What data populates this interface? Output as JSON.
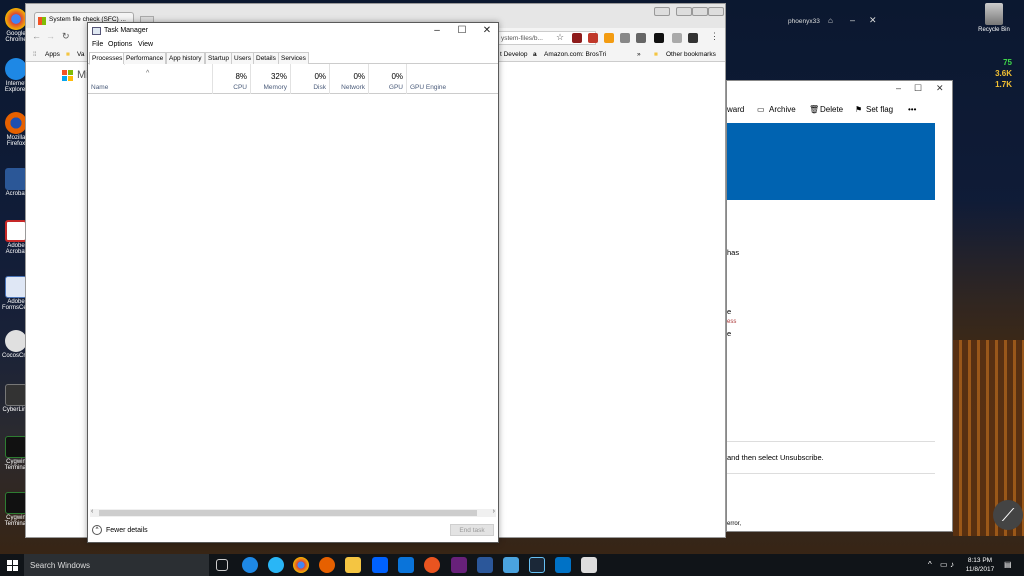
{
  "desktop": {
    "icons": [
      {
        "label": "Google Chrome",
        "color": "#dd4b39"
      },
      {
        "label": "Internet Explorer",
        "color": "#1e88e5"
      },
      {
        "label": "Mozilla Firefox",
        "color": "#e66000"
      },
      {
        "label": "Acrobat",
        "color": "#2b5797"
      },
      {
        "label": "Adobe Acrobat",
        "color": "#c62828"
      },
      {
        "label": "Adobe FormsCentral",
        "color": "#4a74b8"
      },
      {
        "label": "CocosCreator",
        "color": "#e0e0e0"
      },
      {
        "label": "CyberLink",
        "color": "#333333"
      },
      {
        "label": "Cygwin Terminal",
        "color": "#2e7d32"
      },
      {
        "label": "Cygwin Terminal",
        "color": "#2e7d32"
      }
    ],
    "recycle_bin": "Recycle Bin",
    "hw_monitor": {
      "line1": "75",
      "line2": "3.6K",
      "line3": "1.7K"
    }
  },
  "chrome": {
    "tab_title": "System file check (SFC) ...",
    "address": "ystem-files/b...",
    "bookmarks_apps": "Apps",
    "bookmarks": [
      "Va",
      "t Develop",
      "Amazon.com: BrosTri",
      "Other bookmarks"
    ],
    "ms_text": "Mi"
  },
  "mail": {
    "toolbar": {
      "forward": "ward",
      "archive": "Archive",
      "delete": "Delete",
      "set_flag": "Set flag",
      "more": "•••"
    },
    "user": "phoenyx33",
    "snippets": [
      "has",
      "e",
      "ess",
      "e"
    ],
    "unsubscribe": "and then select Unsubscribe.",
    "footer": "error,"
  },
  "taskmanager": {
    "title": "Task Manager",
    "menu": [
      "File",
      "Options",
      "View"
    ],
    "tabs": [
      "Processes",
      "Performance",
      "App history",
      "Startup",
      "Users",
      "Details",
      "Services"
    ],
    "active_tab": "Processes",
    "columns": {
      "name": "Name",
      "cpu": {
        "pct": "8%",
        "label": "CPU"
      },
      "memory": {
        "pct": "32%",
        "label": "Memory"
      },
      "disk": {
        "pct": "0%",
        "label": "Disk"
      },
      "network": {
        "pct": "0%",
        "label": "Network"
      },
      "gpu": {
        "pct": "0%",
        "label": "GPU"
      },
      "gpu_engine": "GPU Engine"
    },
    "fewer_details": "Fewer details",
    "end_task": "End task"
  },
  "taskbar": {
    "search_placeholder": "Search Windows",
    "time": "8:13 PM",
    "date": "11/8/2017"
  }
}
